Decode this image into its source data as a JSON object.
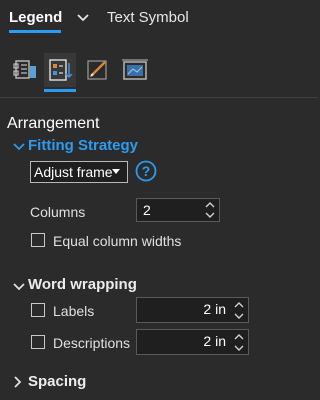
{
  "tabs": {
    "active": "Legend",
    "other": "Text Symbol"
  },
  "toolbar": {
    "icons": [
      "legend-options-icon",
      "arrangement-icon",
      "symbol-pen-icon",
      "display-frame-icon"
    ],
    "active_index": 1
  },
  "arrangement": {
    "title": "Arrangement",
    "fitting_strategy": {
      "title": "Fitting Strategy",
      "dropdown_value": "Adjust frame",
      "columns_label": "Columns",
      "columns_value": "2",
      "equal_widths_label": "Equal column widths",
      "equal_widths_checked": false
    },
    "word_wrapping": {
      "title": "Word wrapping",
      "labels_label": "Labels",
      "labels_checked": false,
      "labels_value": "2 in",
      "descriptions_label": "Descriptions",
      "descriptions_checked": false,
      "descriptions_value": "2 in"
    },
    "spacing": {
      "title": "Spacing"
    }
  },
  "colors": {
    "accent": "#2d9bf0",
    "background": "#2b2b2b"
  }
}
